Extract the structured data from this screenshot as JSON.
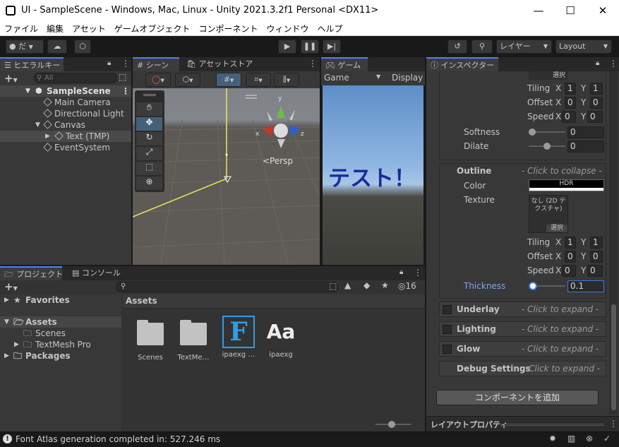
{
  "window": {
    "title": "UI - SampleScene - Windows, Mac, Linux - Unity 2021.3.2f1 Personal <DX11>"
  },
  "menu": [
    "ファイル",
    "編集",
    "アセット",
    "ゲームオブジェクト",
    "コンポーネント",
    "ウィンドウ",
    "ヘルプ"
  ],
  "toolbar": {
    "account_label": "だ",
    "layers_label": "レイヤー",
    "layout_label": "Layout"
  },
  "hierarchy": {
    "tab_label": "ヒエラルキー",
    "search_placeholder": "All",
    "items": [
      {
        "label": "SampleScene"
      },
      {
        "label": "Main Camera"
      },
      {
        "label": "Directional Light"
      },
      {
        "label": "Canvas"
      },
      {
        "label": "Text (TMP)"
      },
      {
        "label": "EventSystem"
      }
    ]
  },
  "scene": {
    "tab_label": "シーン",
    "asset_store_tab": "アセットストア",
    "persp_label": "<Persp",
    "axis_y": "y",
    "axis_x": "x",
    "axis_z": "z"
  },
  "game": {
    "tab_label": "ゲーム",
    "display_select": "Game",
    "display_label": "Display",
    "preview_text": "テスト！"
  },
  "project": {
    "tab_label": "プロジェクト",
    "console_tab": "コンソール",
    "hidden_count": "16",
    "tree": [
      {
        "label": "Favorites"
      },
      {
        "label": "Assets"
      },
      {
        "label": "Scenes"
      },
      {
        "label": "TextMesh Pro"
      },
      {
        "label": "Packages"
      }
    ],
    "breadcrumb": "Assets",
    "assets": [
      {
        "label": "Scenes"
      },
      {
        "label": "TextMe…"
      },
      {
        "label": "ipaexg …"
      },
      {
        "label": "ipaexg"
      }
    ]
  },
  "inspector": {
    "tab_label": "インスペクター",
    "select_label": "選択",
    "tiling_label": "Tiling",
    "offset_label": "Offset",
    "speed_label": "Speed",
    "x_label": "X",
    "y_label": "Y",
    "tiling1": {
      "x": "1",
      "y": "1"
    },
    "offset1": {
      "x": "0",
      "y": "0"
    },
    "speed1": {
      "x": "0",
      "y": "0"
    },
    "softness_label": "Softness",
    "softness_value": "0",
    "dilate_label": "Dilate",
    "dilate_value": "0",
    "outline_label": "Outline",
    "outline_hint": "- Click to collapse -",
    "color_label": "Color",
    "color_hdr": "HDR",
    "texture_label": "Texture",
    "texture_none": "なし (2D テクスチャ)",
    "tiling2": {
      "x": "1",
      "y": "1"
    },
    "offset2": {
      "x": "0",
      "y": "0"
    },
    "speed2": {
      "x": "0",
      "y": "0"
    },
    "thickness_label": "Thickness",
    "thickness_value": "0.1",
    "sections": [
      {
        "label": "Underlay",
        "hint": "- Click to expand -"
      },
      {
        "label": "Lighting",
        "hint": "- Click to expand -"
      },
      {
        "label": "Glow",
        "hint": "- Click to expand -"
      },
      {
        "label": "Debug Settings",
        "hint": "Click to expand -"
      }
    ],
    "add_component": "コンポーネントを追加",
    "layout_properties": "レイアウトプロパティ"
  },
  "status": {
    "message": "Font Atlas generation completed in: 527.246 ms"
  }
}
